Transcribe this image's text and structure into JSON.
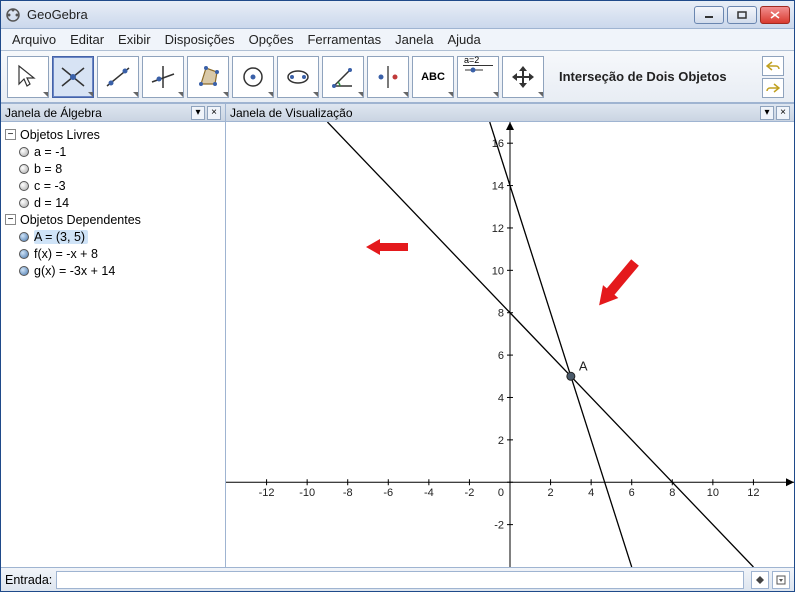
{
  "window": {
    "title": "GeoGebra"
  },
  "menu": [
    "Arquivo",
    "Editar",
    "Exibir",
    "Disposições",
    "Opções",
    "Ferramentas",
    "Janela",
    "Ajuda"
  ],
  "toolbar": {
    "selected_tool_label": "Interseção de Dois Objetos",
    "tools": [
      {
        "name": "move",
        "sel": false
      },
      {
        "name": "intersect",
        "sel": true
      },
      {
        "name": "line-two-points",
        "sel": false
      },
      {
        "name": "perpendicular",
        "sel": false
      },
      {
        "name": "polygon",
        "sel": false
      },
      {
        "name": "circle-center",
        "sel": false
      },
      {
        "name": "ellipse",
        "sel": false
      },
      {
        "name": "angle",
        "sel": false
      },
      {
        "name": "reflect",
        "sel": false
      },
      {
        "name": "text",
        "sel": false,
        "label": "ABC"
      },
      {
        "name": "slider",
        "sel": false,
        "label": "a=2"
      },
      {
        "name": "move-view",
        "sel": false
      }
    ]
  },
  "panes": {
    "algebra_title": "Janela de Álgebra",
    "viz_title": "Janela de Visualização"
  },
  "algebra": {
    "groups": [
      {
        "name": "Objetos Livres",
        "items": [
          {
            "label": "a = -1",
            "filled": false
          },
          {
            "label": "b = 8",
            "filled": false
          },
          {
            "label": "c = -3",
            "filled": false
          },
          {
            "label": "d = 14",
            "filled": false
          }
        ]
      },
      {
        "name": "Objetos Dependentes",
        "items": [
          {
            "label": "A = (3, 5)",
            "filled": true,
            "highlight": true
          },
          {
            "label": "f(x) = -x + 8",
            "filled": true
          },
          {
            "label": "g(x) = -3x + 14",
            "filled": true
          }
        ]
      }
    ]
  },
  "chart_data": {
    "type": "line",
    "title": "",
    "xlabel": "",
    "ylabel": "",
    "xlim": [
      -14,
      14
    ],
    "ylim": [
      -4,
      17
    ],
    "x_ticks": [
      -12,
      -10,
      -8,
      -6,
      -4,
      -2,
      0,
      2,
      4,
      6,
      8,
      10,
      12
    ],
    "y_ticks": [
      -2,
      0,
      2,
      4,
      6,
      8,
      10,
      12,
      14,
      16
    ],
    "series": [
      {
        "name": "f(x) = -x + 8",
        "expr": "y = -x + 8",
        "points": [
          [
            -9,
            17
          ],
          [
            12,
            -4
          ]
        ]
      },
      {
        "name": "g(x) = -3x + 14",
        "expr": "y = -3x + 14",
        "points": [
          [
            -1,
            17
          ],
          [
            6,
            -4
          ]
        ]
      }
    ],
    "points": [
      {
        "name": "A",
        "x": 3,
        "y": 5
      }
    ]
  },
  "input": {
    "label": "Entrada:",
    "value": "",
    "placeholder": ""
  }
}
